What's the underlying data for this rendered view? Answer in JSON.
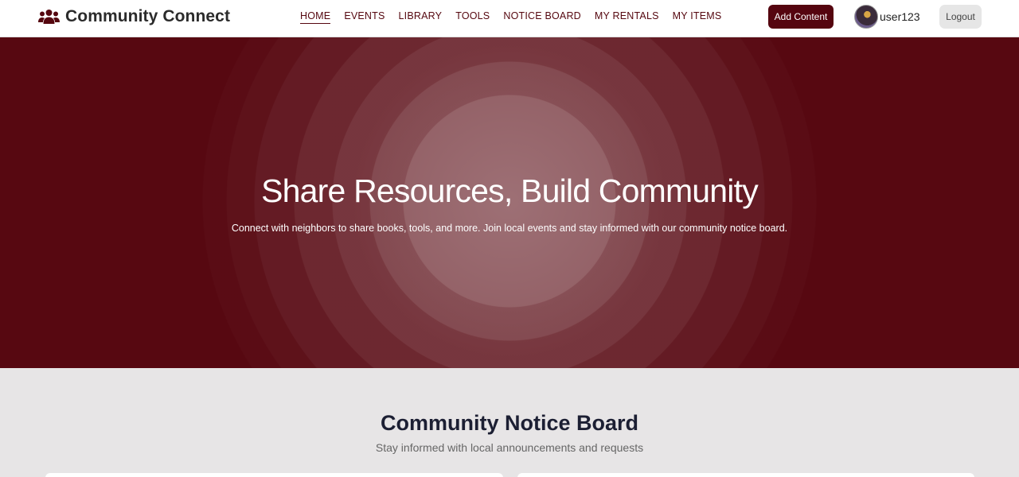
{
  "header": {
    "brand": "Community Connect",
    "brand_icon": "users-group-icon",
    "nav": [
      {
        "label": "HOME",
        "active": true
      },
      {
        "label": "EVENTS"
      },
      {
        "label": "LIBRARY"
      },
      {
        "label": "TOOLS"
      },
      {
        "label": "NOTICE BOARD"
      },
      {
        "label": "MY RENTALS"
      },
      {
        "label": "MY ITEMS"
      }
    ],
    "add_button": "Add Content",
    "username": "user123",
    "logout": "Logout"
  },
  "hero": {
    "title": "Share Resources, Build Community",
    "subtitle": "Connect with neighbors to share books, tools, and more. Join local events and stay informed with our community notice board."
  },
  "notice_board": {
    "title": "Community Notice Board",
    "subtitle": "Stay informed with local announcements and requests"
  },
  "colors": {
    "brand_maroon": "#570811",
    "nav_text": "#55070f",
    "section_bg": "#e7e5e6"
  }
}
